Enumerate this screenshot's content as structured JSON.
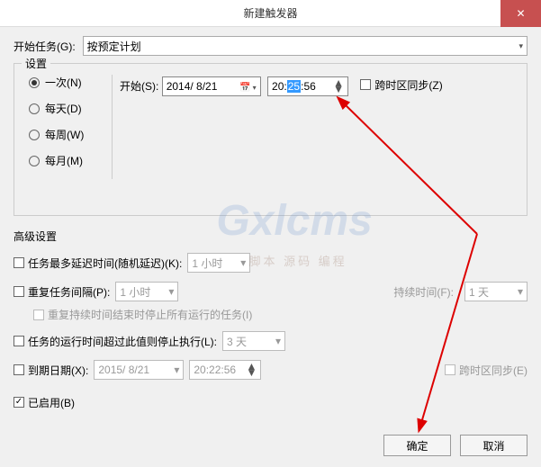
{
  "window": {
    "title": "新建触发器"
  },
  "task": {
    "label": "开始任务(G):",
    "value": "按预定计划"
  },
  "settings": {
    "legend": "设置",
    "radios": {
      "once": "一次(N)",
      "daily": "每天(D)",
      "weekly": "每周(W)",
      "monthly": "每月(M)"
    },
    "start_label": "开始(S):",
    "date": "2014/ 8/21",
    "time_h": "20",
    "time_m": "25",
    "time_s": "56",
    "sync_label": "跨时区同步(Z)"
  },
  "adv": {
    "title": "高级设置",
    "delay_label": "任务最多延迟时间(随机延迟)(K):",
    "delay_value": "1 小时",
    "repeat_label": "重复任务间隔(P):",
    "repeat_value": "1 小时",
    "duration_label": "持续时间(F):",
    "duration_value": "1 天",
    "repeat_end_label": "重复持续时间结束时停止所有运行的任务(I)",
    "stop_label": "任务的运行时间超过此值则停止执行(L):",
    "stop_value": "3 天",
    "expire_label": "到期日期(X):",
    "expire_date": "2015/ 8/21",
    "expire_time": "20:22:56",
    "expire_sync": "跨时区同步(E)",
    "enabled_label": "已启用(B)"
  },
  "buttons": {
    "ok": "确定",
    "cancel": "取消"
  },
  "watermark": {
    "main": "Gxlcms",
    "sub": "脚本 源码 编程"
  }
}
